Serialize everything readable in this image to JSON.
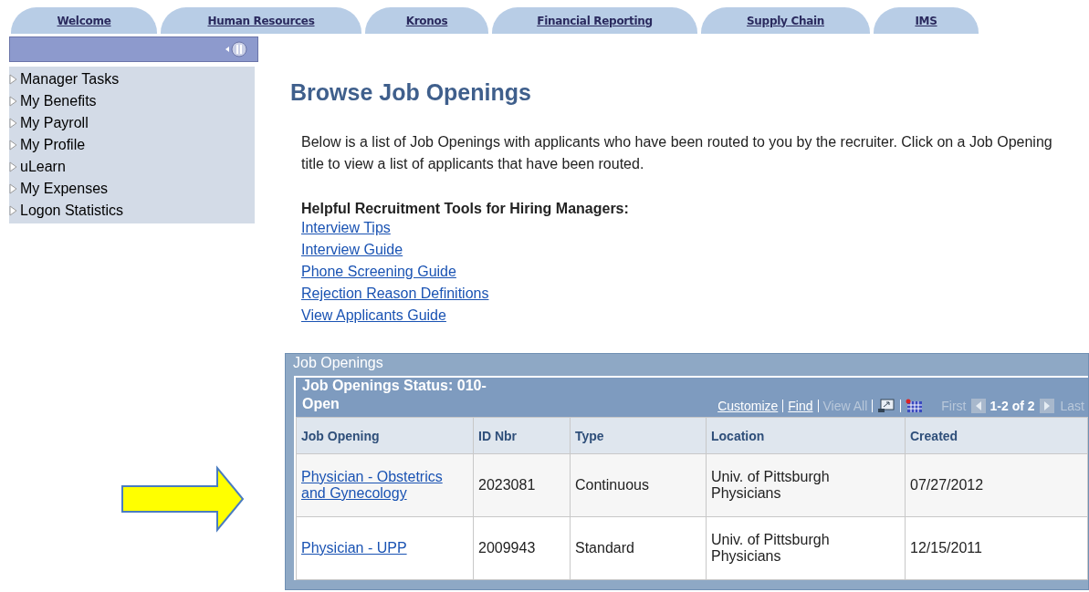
{
  "tabs": [
    {
      "label": "Welcome"
    },
    {
      "label": "Human Resources"
    },
    {
      "label": "Kronos"
    },
    {
      "label": "Financial Reporting"
    },
    {
      "label": "Supply Chain"
    },
    {
      "label": "IMS"
    }
  ],
  "sidebar": {
    "items": [
      {
        "label": "Manager Tasks"
      },
      {
        "label": "My Benefits"
      },
      {
        "label": "My Payroll"
      },
      {
        "label": "My Profile"
      },
      {
        "label": "uLearn"
      },
      {
        "label": "My Expenses"
      },
      {
        "label": "Logon Statistics"
      }
    ]
  },
  "page_title": "Browse Job Openings",
  "intro": "Below is a list of Job Openings with applicants who have been routed to you by the recruiter. Click on a Job Opening title to view a list of applicants that have been routed.",
  "tools_heading": "Helpful Recruitment Tools for Hiring Managers:",
  "tools_links": [
    "Interview Tips",
    "Interview Guide",
    "Phone Screening Guide",
    "Rejection Reason Definitions",
    "View Applicants Guide"
  ],
  "grid": {
    "title": "Job Openings",
    "subtitle": "Job Openings Status: 010-Open",
    "toolbar": [
      {
        "label": "Customize",
        "disabled": false
      },
      {
        "label": "Find",
        "disabled": false
      },
      {
        "label": "View All",
        "disabled": true
      }
    ],
    "pager": {
      "first": "First",
      "range": "1-2 of 2",
      "last": "Last"
    },
    "columns": [
      "Job Opening",
      "ID Nbr",
      "Type",
      "Location",
      "Created"
    ],
    "rows": [
      [
        "Physician - Obstetrics and Gynecology",
        "2023081",
        "Continuous",
        "Univ. of Pittsburgh Physicians",
        "07/27/2012"
      ],
      [
        "Physician - UPP",
        "2009943",
        "Standard",
        "Univ. of Pittsburgh Physicians",
        "12/15/2011"
      ]
    ]
  }
}
